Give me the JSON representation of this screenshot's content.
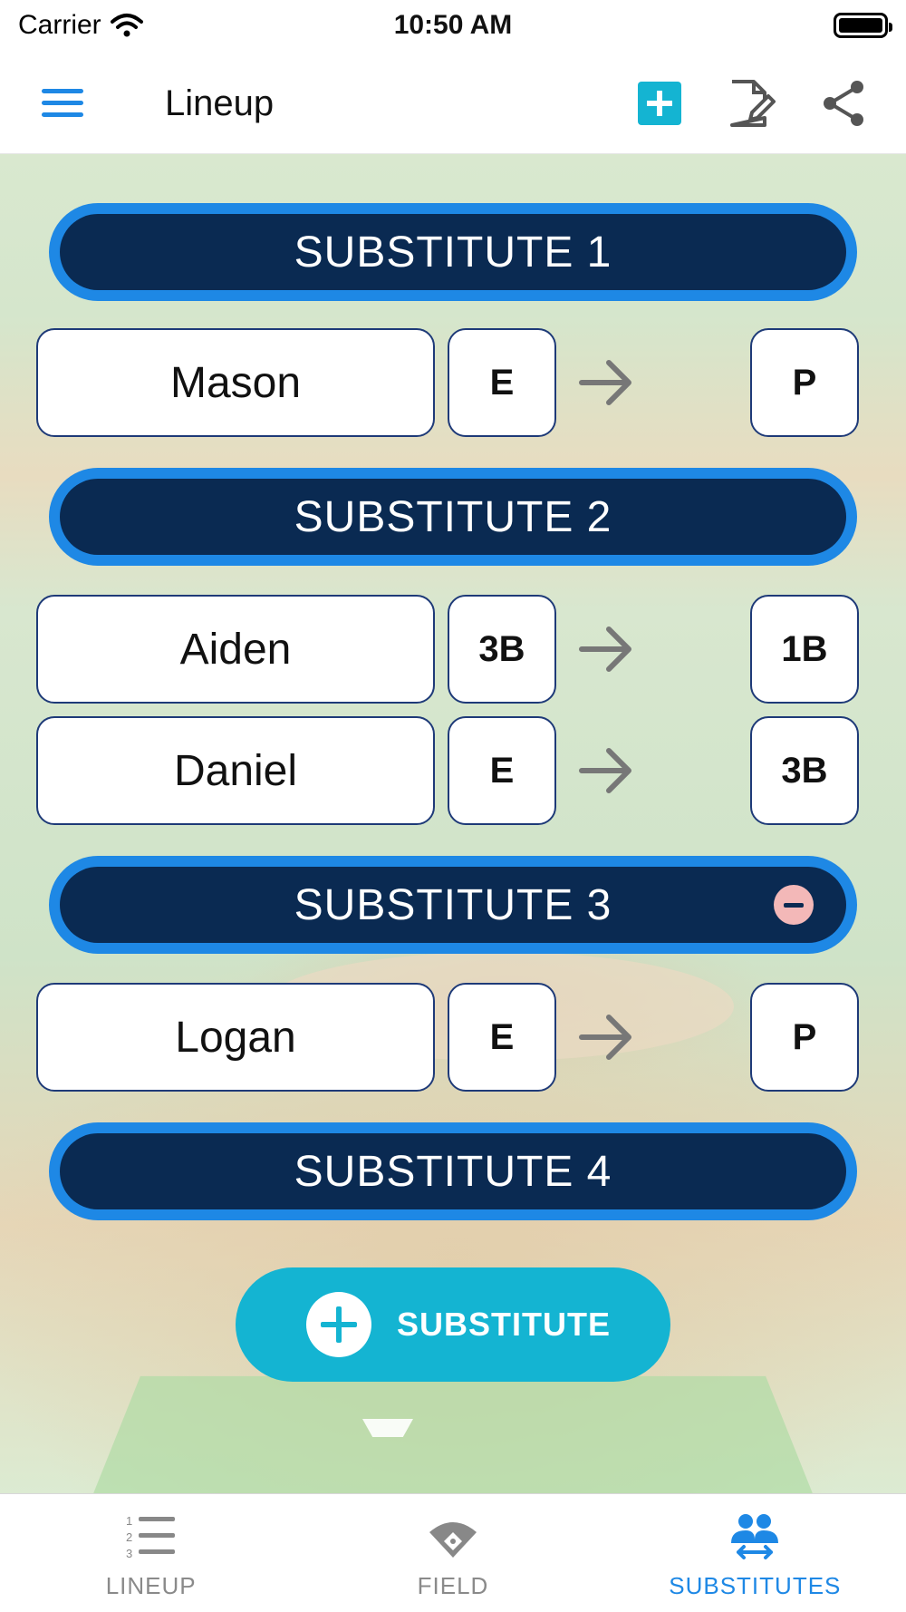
{
  "status_bar": {
    "carrier": "Carrier",
    "time": "10:50 AM"
  },
  "nav": {
    "title": "Lineup",
    "icons": [
      "menu-icon",
      "add-square-icon",
      "edit-document-icon",
      "share-icon"
    ],
    "accent_color": "#1e88e5",
    "add_color": "#14b4d2"
  },
  "substitutes": [
    {
      "label": "SUBSTITUTE 1",
      "rows": [
        {
          "name": "Mason",
          "from": "E",
          "to": "P"
        }
      ]
    },
    {
      "label": "SUBSTITUTE 2",
      "rows": [
        {
          "name": "Aiden",
          "from": "3B",
          "to": "1B"
        },
        {
          "name": "Daniel",
          "from": "E",
          "to": "3B"
        }
      ]
    },
    {
      "label": "SUBSTITUTE 3",
      "removable": true,
      "rows": [
        {
          "name": "Logan",
          "from": "E",
          "to": "P"
        }
      ]
    },
    {
      "label": "SUBSTITUTE 4",
      "rows": []
    }
  ],
  "add_button": {
    "label": "SUBSTITUTE"
  },
  "tabs": [
    {
      "label": "LINEUP",
      "icon": "numbered-list-icon",
      "active": false
    },
    {
      "label": "FIELD",
      "icon": "baseball-field-icon",
      "active": false
    },
    {
      "label": "SUBSTITUTES",
      "icon": "swap-people-icon",
      "active": true
    }
  ],
  "colors": {
    "header_fill": "#0a2a52",
    "header_border": "#1e88e5",
    "active_tab": "#1e88e5"
  }
}
